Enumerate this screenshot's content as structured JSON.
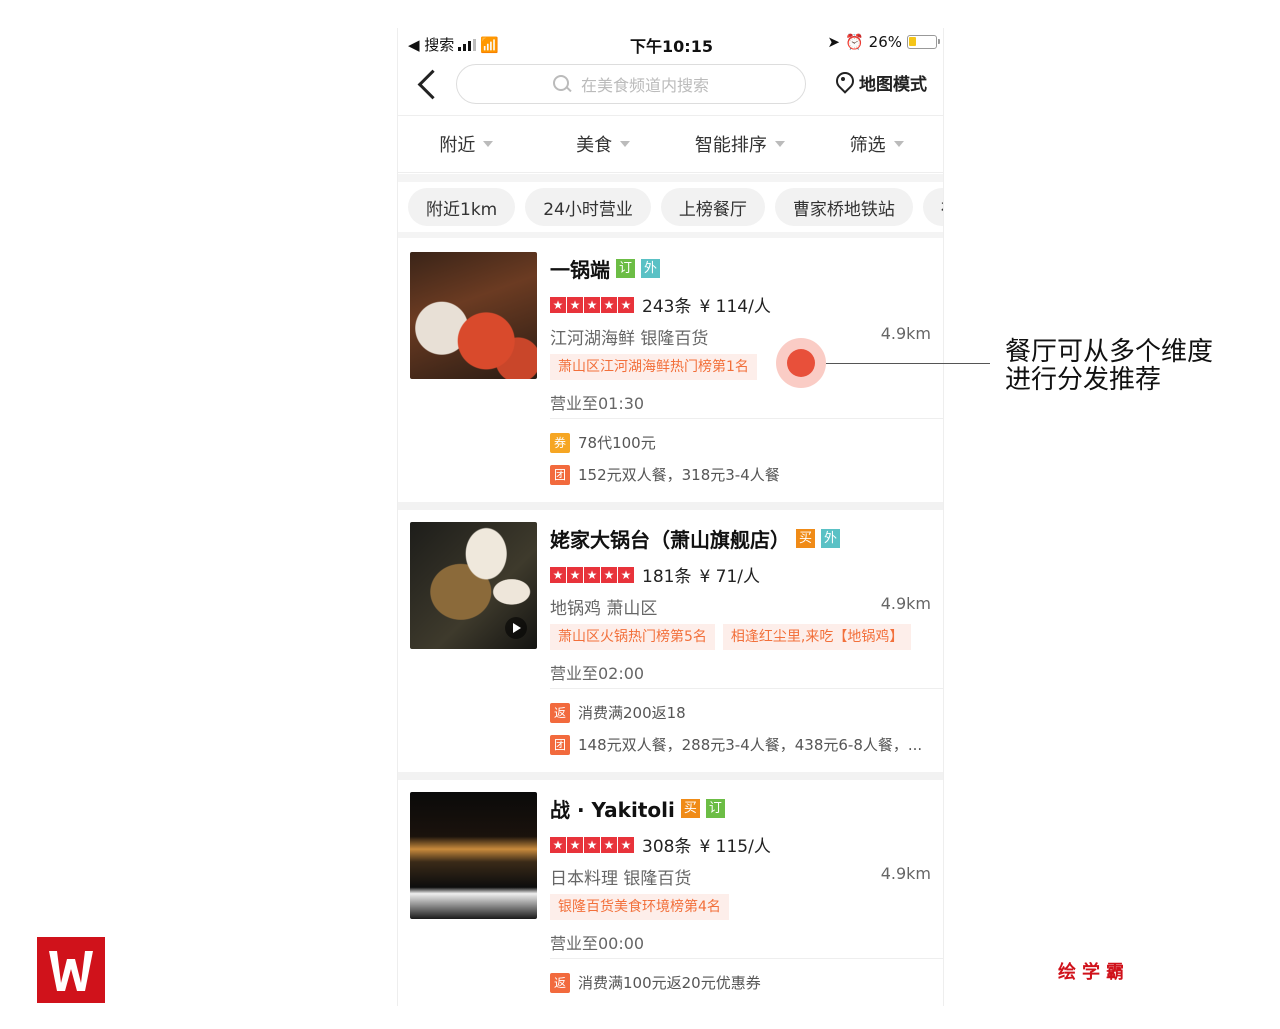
{
  "status_bar": {
    "back_app": "◀ 搜索",
    "time": "下午10:15",
    "battery": "26%",
    "battery_level": 0.26
  },
  "search": {
    "placeholder": "在美食频道内搜索",
    "map_mode": "地图模式"
  },
  "filters": [
    "附近",
    "美食",
    "智能排序",
    "筛选"
  ],
  "chips": [
    "附近1km",
    "24小时营业",
    "上榜餐厅",
    "曹家桥地铁站",
    "夜"
  ],
  "restaurants": [
    {
      "name": "一锅端",
      "badges": [
        "订",
        "外"
      ],
      "rating": 5,
      "reviews": "243条",
      "price": "¥ 114/人",
      "category": "江河湖海鲜   银隆百货",
      "distance": "4.9km",
      "tags": [
        "萧山区江河湖海鲜热门榜第1名"
      ],
      "hours": "营业至01:30",
      "deals": [
        {
          "icon": "券",
          "text": "78代100元"
        },
        {
          "icon": "团",
          "text": "152元双人餐，318元3-4人餐"
        }
      ]
    },
    {
      "name": "姥家大锅台（萧山旗舰店）",
      "badges": [
        "买",
        "外"
      ],
      "rating": 5,
      "reviews": "181条",
      "price": "¥ 71/人",
      "category": "地锅鸡   萧山区",
      "distance": "4.9km",
      "tags": [
        "萧山区火锅热门榜第5名",
        "相逢红尘里,来吃【地锅鸡】"
      ],
      "hours": "营业至02:00",
      "deals": [
        {
          "icon": "返",
          "text": "消费满200返18"
        },
        {
          "icon": "团",
          "text": "148元双人餐，288元3-4人餐，438元6-8人餐，..."
        }
      ]
    },
    {
      "name": "战 · Yakitoli",
      "badges": [
        "买",
        "订"
      ],
      "rating": 5,
      "reviews": "308条",
      "price": "¥ 115/人",
      "category": "日本料理   银隆百货",
      "distance": "4.9km",
      "tags": [
        "银隆百货美食环境榜第4名"
      ],
      "hours": "营业至00:00",
      "deals": [
        {
          "icon": "返",
          "text": "消费满100元返20元优惠券"
        }
      ]
    }
  ],
  "annotation": {
    "line1": "餐厅可从多个维度",
    "line2": "进行分发推荐"
  },
  "brand": "绘学霸",
  "colors": {
    "accent": "#f2703b",
    "star": "#e8333b",
    "logo": "#d0121b"
  }
}
